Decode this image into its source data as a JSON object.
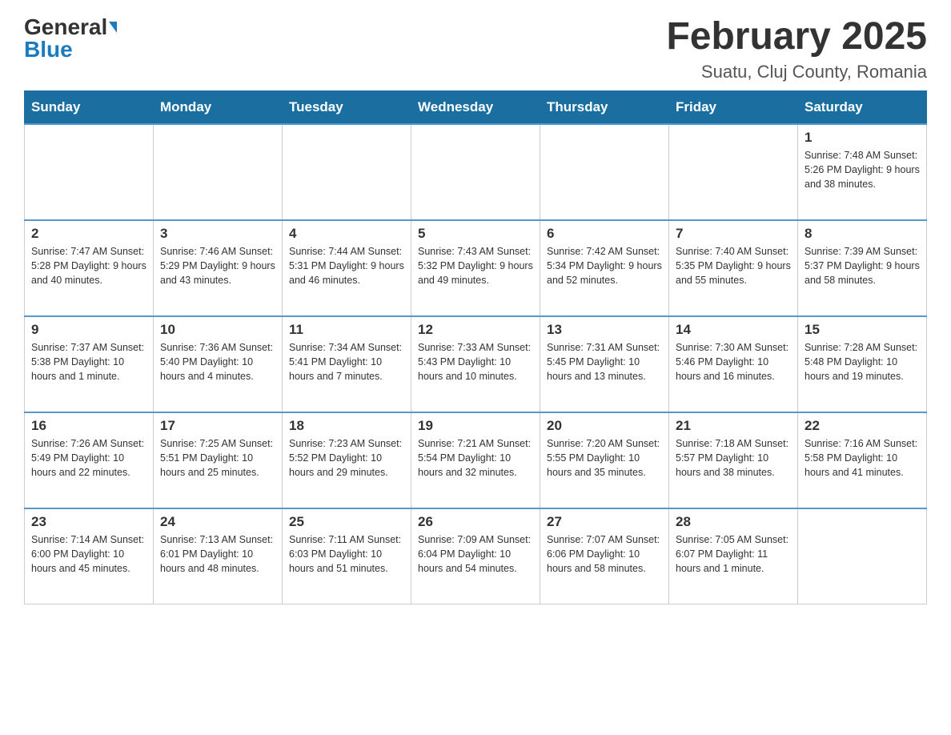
{
  "logo": {
    "general": "General",
    "blue": "Blue"
  },
  "title": {
    "month": "February 2025",
    "location": "Suatu, Cluj County, Romania"
  },
  "days_header": [
    "Sunday",
    "Monday",
    "Tuesday",
    "Wednesday",
    "Thursday",
    "Friday",
    "Saturday"
  ],
  "weeks": [
    [
      {
        "day": "",
        "info": ""
      },
      {
        "day": "",
        "info": ""
      },
      {
        "day": "",
        "info": ""
      },
      {
        "day": "",
        "info": ""
      },
      {
        "day": "",
        "info": ""
      },
      {
        "day": "",
        "info": ""
      },
      {
        "day": "1",
        "info": "Sunrise: 7:48 AM\nSunset: 5:26 PM\nDaylight: 9 hours and 38 minutes."
      }
    ],
    [
      {
        "day": "2",
        "info": "Sunrise: 7:47 AM\nSunset: 5:28 PM\nDaylight: 9 hours and 40 minutes."
      },
      {
        "day": "3",
        "info": "Sunrise: 7:46 AM\nSunset: 5:29 PM\nDaylight: 9 hours and 43 minutes."
      },
      {
        "day": "4",
        "info": "Sunrise: 7:44 AM\nSunset: 5:31 PM\nDaylight: 9 hours and 46 minutes."
      },
      {
        "day": "5",
        "info": "Sunrise: 7:43 AM\nSunset: 5:32 PM\nDaylight: 9 hours and 49 minutes."
      },
      {
        "day": "6",
        "info": "Sunrise: 7:42 AM\nSunset: 5:34 PM\nDaylight: 9 hours and 52 minutes."
      },
      {
        "day": "7",
        "info": "Sunrise: 7:40 AM\nSunset: 5:35 PM\nDaylight: 9 hours and 55 minutes."
      },
      {
        "day": "8",
        "info": "Sunrise: 7:39 AM\nSunset: 5:37 PM\nDaylight: 9 hours and 58 minutes."
      }
    ],
    [
      {
        "day": "9",
        "info": "Sunrise: 7:37 AM\nSunset: 5:38 PM\nDaylight: 10 hours and 1 minute."
      },
      {
        "day": "10",
        "info": "Sunrise: 7:36 AM\nSunset: 5:40 PM\nDaylight: 10 hours and 4 minutes."
      },
      {
        "day": "11",
        "info": "Sunrise: 7:34 AM\nSunset: 5:41 PM\nDaylight: 10 hours and 7 minutes."
      },
      {
        "day": "12",
        "info": "Sunrise: 7:33 AM\nSunset: 5:43 PM\nDaylight: 10 hours and 10 minutes."
      },
      {
        "day": "13",
        "info": "Sunrise: 7:31 AM\nSunset: 5:45 PM\nDaylight: 10 hours and 13 minutes."
      },
      {
        "day": "14",
        "info": "Sunrise: 7:30 AM\nSunset: 5:46 PM\nDaylight: 10 hours and 16 minutes."
      },
      {
        "day": "15",
        "info": "Sunrise: 7:28 AM\nSunset: 5:48 PM\nDaylight: 10 hours and 19 minutes."
      }
    ],
    [
      {
        "day": "16",
        "info": "Sunrise: 7:26 AM\nSunset: 5:49 PM\nDaylight: 10 hours and 22 minutes."
      },
      {
        "day": "17",
        "info": "Sunrise: 7:25 AM\nSunset: 5:51 PM\nDaylight: 10 hours and 25 minutes."
      },
      {
        "day": "18",
        "info": "Sunrise: 7:23 AM\nSunset: 5:52 PM\nDaylight: 10 hours and 29 minutes."
      },
      {
        "day": "19",
        "info": "Sunrise: 7:21 AM\nSunset: 5:54 PM\nDaylight: 10 hours and 32 minutes."
      },
      {
        "day": "20",
        "info": "Sunrise: 7:20 AM\nSunset: 5:55 PM\nDaylight: 10 hours and 35 minutes."
      },
      {
        "day": "21",
        "info": "Sunrise: 7:18 AM\nSunset: 5:57 PM\nDaylight: 10 hours and 38 minutes."
      },
      {
        "day": "22",
        "info": "Sunrise: 7:16 AM\nSunset: 5:58 PM\nDaylight: 10 hours and 41 minutes."
      }
    ],
    [
      {
        "day": "23",
        "info": "Sunrise: 7:14 AM\nSunset: 6:00 PM\nDaylight: 10 hours and 45 minutes."
      },
      {
        "day": "24",
        "info": "Sunrise: 7:13 AM\nSunset: 6:01 PM\nDaylight: 10 hours and 48 minutes."
      },
      {
        "day": "25",
        "info": "Sunrise: 7:11 AM\nSunset: 6:03 PM\nDaylight: 10 hours and 51 minutes."
      },
      {
        "day": "26",
        "info": "Sunrise: 7:09 AM\nSunset: 6:04 PM\nDaylight: 10 hours and 54 minutes."
      },
      {
        "day": "27",
        "info": "Sunrise: 7:07 AM\nSunset: 6:06 PM\nDaylight: 10 hours and 58 minutes."
      },
      {
        "day": "28",
        "info": "Sunrise: 7:05 AM\nSunset: 6:07 PM\nDaylight: 11 hours and 1 minute."
      },
      {
        "day": "",
        "info": ""
      }
    ]
  ]
}
